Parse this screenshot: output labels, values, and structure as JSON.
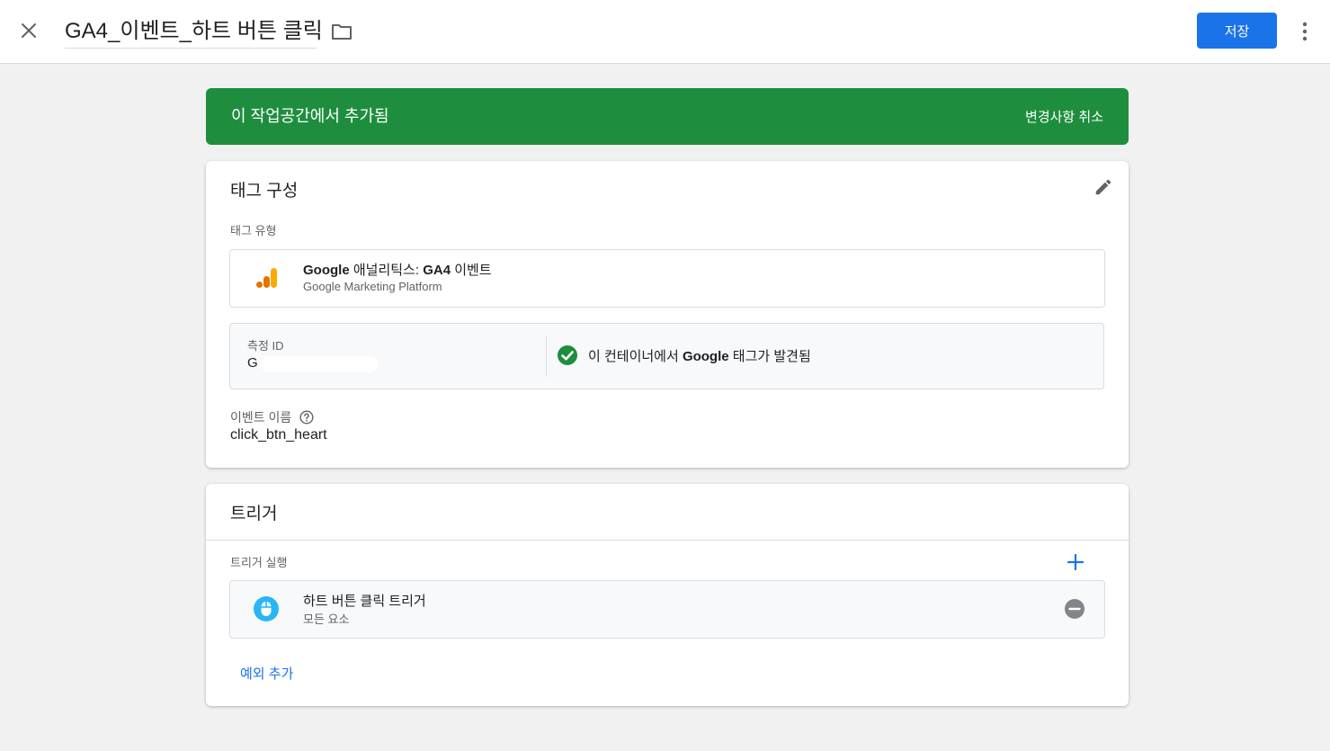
{
  "header": {
    "title": "GA4_이벤트_하트 버튼 클릭",
    "save_label": "저장"
  },
  "banner": {
    "text": "이 작업공간에서 추가됨",
    "undo_label": "변경사항 취소",
    "color": "#1e8e3e"
  },
  "tag_config": {
    "title": "태그 구성",
    "tag_type_label": "태그 유형",
    "tag_type": {
      "name_prefix": "Google",
      "name_middle": " 애널리틱스: ",
      "name_bold": "GA4",
      "name_suffix": " 이벤트",
      "platform": "Google Marketing Platform",
      "icon": "google-analytics-icon"
    },
    "measurement": {
      "label": "측정 ID",
      "value": "G",
      "status_prefix": "이 컨테이너에서 ",
      "status_bold": "Google",
      "status_suffix": " 태그가 발견됨",
      "status_icon": "check-circle-icon"
    },
    "event_name_label": "이벤트 이름",
    "event_name_value": "click_btn_heart"
  },
  "trigger": {
    "title": "트리거",
    "firing_label": "트리거 실행",
    "items": [
      {
        "name": "하트 버튼 클릭 트리거",
        "subtitle": "모든 요소",
        "icon": "mouse-icon"
      }
    ],
    "add_exception_label": "예외 추가"
  },
  "colors": {
    "accent": "#1a73e8",
    "success": "#1e8e3e",
    "ga_orange": "#f9ab00",
    "ga_dark_orange": "#e37400",
    "mouse_blue": "#29b6f6"
  }
}
